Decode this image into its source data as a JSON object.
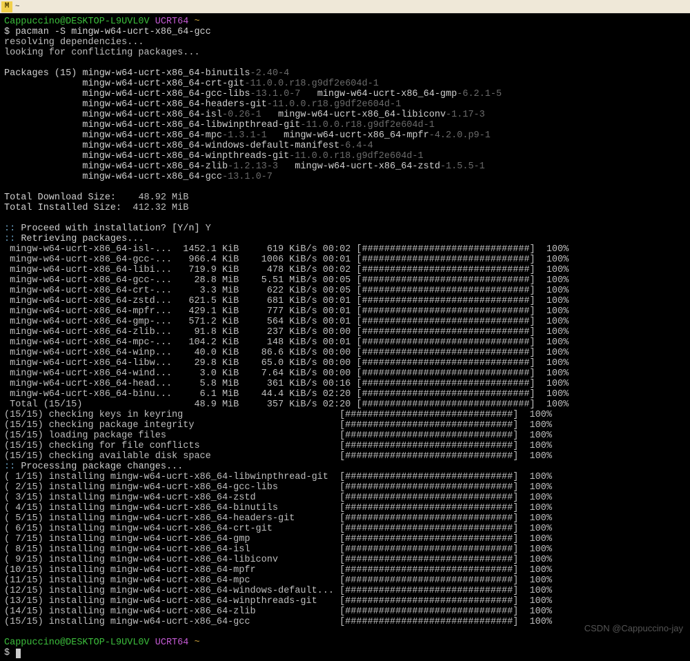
{
  "window": {
    "title": "~"
  },
  "prompt": {
    "user_host": "Cappuccino@DESKTOP-L9UVL0V",
    "env": "UCRT64",
    "path": "~"
  },
  "command": "$ pacman -S mingw-w64-ucrt-x86_64-gcc",
  "status": {
    "resolving": "resolving dependencies...",
    "conflict": "looking for conflicting packages..."
  },
  "packages_header": "Packages (15)",
  "packages": [
    {
      "name": "mingw-w64-ucrt-x86_64-binutils",
      "ver": "-2.40-4"
    },
    {
      "name": "mingw-w64-ucrt-x86_64-crt-git",
      "ver": "-11.0.0.r18.g9df2e604d-1"
    },
    {
      "name": "mingw-w64-ucrt-x86_64-gcc-libs",
      "ver": "-13.1.0-7"
    },
    {
      "name": "mingw-w64-ucrt-x86_64-gmp",
      "ver": "-6.2.1-5"
    },
    {
      "name": "mingw-w64-ucrt-x86_64-headers-git",
      "ver": "-11.0.0.r18.g9df2e604d-1"
    },
    {
      "name": "mingw-w64-ucrt-x86_64-isl",
      "ver": "-0.26-1"
    },
    {
      "name": "mingw-w64-ucrt-x86_64-libiconv",
      "ver": "-1.17-3"
    },
    {
      "name": "mingw-w64-ucrt-x86_64-libwinpthread-git",
      "ver": "-11.0.0.r18.g9df2e604d-1"
    },
    {
      "name": "mingw-w64-ucrt-x86_64-mpc",
      "ver": "-1.3.1-1"
    },
    {
      "name": "mingw-w64-ucrt-x86_64-mpfr",
      "ver": "-4.2.0.p9-1"
    },
    {
      "name": "mingw-w64-ucrt-x86_64-windows-default-manifest",
      "ver": "-6.4-4"
    },
    {
      "name": "mingw-w64-ucrt-x86_64-winpthreads-git",
      "ver": "-11.0.0.r18.g9df2e604d-1"
    },
    {
      "name": "mingw-w64-ucrt-x86_64-zlib",
      "ver": "-1.2.13-3"
    },
    {
      "name": "mingw-w64-ucrt-x86_64-zstd",
      "ver": "-1.5.5-1"
    },
    {
      "name": "mingw-w64-ucrt-x86_64-gcc",
      "ver": "-13.1.0-7"
    }
  ],
  "sizes": {
    "download_lbl": "Total Download Size:",
    "download_val": "48.92 MiB",
    "install_lbl": "Total Installed Size:",
    "install_val": "412.32 MiB"
  },
  "proceed": {
    "msg": ":: Proceed with installation? [Y/n]",
    "ans": " Y"
  },
  "retrieving": ":: Retrieving packages...",
  "bar": "[##############################]",
  "pct": "100%",
  "downloads": [
    {
      "name": " mingw-w64-ucrt-x86_64-isl-...",
      "size": "1452.1 KiB",
      "rate": "  619 KiB/s",
      "time": "00:02"
    },
    {
      "name": " mingw-w64-ucrt-x86_64-gcc-...",
      "size": " 966.4 KiB",
      "rate": " 1006 KiB/s",
      "time": "00:01"
    },
    {
      "name": " mingw-w64-ucrt-x86_64-libi...",
      "size": " 719.9 KiB",
      "rate": "  478 KiB/s",
      "time": "00:02"
    },
    {
      "name": " mingw-w64-ucrt-x86_64-gcc-...",
      "size": "  28.8 MiB",
      "rate": " 5.51 MiB/s",
      "time": "00:05"
    },
    {
      "name": " mingw-w64-ucrt-x86_64-crt-...",
      "size": "   3.3 MiB",
      "rate": "  622 KiB/s",
      "time": "00:05"
    },
    {
      "name": " mingw-w64-ucrt-x86_64-zstd...",
      "size": " 621.5 KiB",
      "rate": "  681 KiB/s",
      "time": "00:01"
    },
    {
      "name": " mingw-w64-ucrt-x86_64-mpfr...",
      "size": " 429.1 KiB",
      "rate": "  777 KiB/s",
      "time": "00:01"
    },
    {
      "name": " mingw-w64-ucrt-x86_64-gmp-...",
      "size": " 571.2 KiB",
      "rate": "  564 KiB/s",
      "time": "00:01"
    },
    {
      "name": " mingw-w64-ucrt-x86_64-zlib...",
      "size": "  91.8 KiB",
      "rate": "  237 KiB/s",
      "time": "00:00"
    },
    {
      "name": " mingw-w64-ucrt-x86_64-mpc-...",
      "size": " 104.2 KiB",
      "rate": "  148 KiB/s",
      "time": "00:01"
    },
    {
      "name": " mingw-w64-ucrt-x86_64-winp...",
      "size": "  40.0 KiB",
      "rate": " 86.6 KiB/s",
      "time": "00:00"
    },
    {
      "name": " mingw-w64-ucrt-x86_64-libw...",
      "size": "  29.8 KiB",
      "rate": " 65.0 KiB/s",
      "time": "00:00"
    },
    {
      "name": " mingw-w64-ucrt-x86_64-wind...",
      "size": "   3.0 KiB",
      "rate": " 7.64 KiB/s",
      "time": "00:00"
    },
    {
      "name": " mingw-w64-ucrt-x86_64-head...",
      "size": "   5.8 MiB",
      "rate": "  361 KiB/s",
      "time": "00:16"
    },
    {
      "name": " mingw-w64-ucrt-x86_64-binu...",
      "size": "   6.1 MiB",
      "rate": " 44.4 KiB/s",
      "time": "02:20"
    },
    {
      "name": " Total (15/15)              ",
      "size": "  48.9 MiB",
      "rate": "  357 KiB/s",
      "time": "02:20"
    }
  ],
  "checks": [
    "(15/15) checking keys in keyring",
    "(15/15) checking package integrity",
    "(15/15) loading package files",
    "(15/15) checking for file conflicts",
    "(15/15) checking available disk space"
  ],
  "processing": ":: Processing package changes...",
  "installs": [
    "( 1/15) installing mingw-w64-ucrt-x86_64-libwinpthread-git",
    "( 2/15) installing mingw-w64-ucrt-x86_64-gcc-libs",
    "( 3/15) installing mingw-w64-ucrt-x86_64-zstd",
    "( 4/15) installing mingw-w64-ucrt-x86_64-binutils",
    "( 5/15) installing mingw-w64-ucrt-x86_64-headers-git",
    "( 6/15) installing mingw-w64-ucrt-x86_64-crt-git",
    "( 7/15) installing mingw-w64-ucrt-x86_64-gmp",
    "( 8/15) installing mingw-w64-ucrt-x86_64-isl",
    "( 9/15) installing mingw-w64-ucrt-x86_64-libiconv",
    "(10/15) installing mingw-w64-ucrt-x86_64-mpfr",
    "(11/15) installing mingw-w64-ucrt-x86_64-mpc",
    "(12/15) installing mingw-w64-ucrt-x86_64-windows-default...",
    "(13/15) installing mingw-w64-ucrt-x86_64-winpthreads-git",
    "(14/15) installing mingw-w64-ucrt-x86_64-zlib",
    "(15/15) installing mingw-w64-ucrt-x86_64-gcc"
  ],
  "prompt2": "$ ",
  "watermark": "CSDN @Cappuccino-jay"
}
